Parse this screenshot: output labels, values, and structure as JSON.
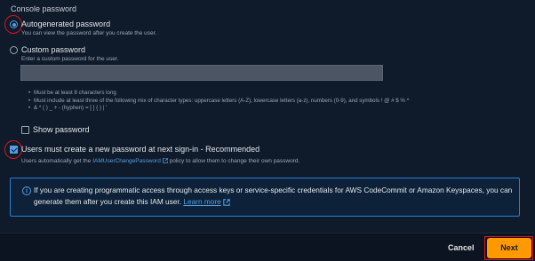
{
  "console_password": {
    "section_title": "Console password",
    "autogenerated": {
      "label": "Autogenerated password",
      "description": "You can view the password after you create the user.",
      "selected": true
    },
    "custom": {
      "label": "Custom password",
      "description": "Enter a custom password for the user.",
      "selected": false,
      "value": ""
    },
    "rules": [
      "Must be at least 8 characters long",
      "Must include at least three of the following mix of character types: uppercase letters (A-Z), lowercase letters (a-z), numbers (0-9), and symbols ! @ # $ % ^",
      "& * ( ) _ + - (hyphen) = [ ] { } | '"
    ],
    "show_password": {
      "label": "Show password",
      "checked": false
    },
    "require_reset": {
      "label": "Users must create a new password at next sign-in - Recommended",
      "checked": true,
      "desc_prefix": "Users automatically get the",
      "policy_link": "IAMUserChangePassword",
      "desc_suffix": "policy to allow them to change their own password."
    }
  },
  "info_alert": {
    "icon": "info-icon",
    "text": "If you are creating programmatic access through access keys or service-specific credentials for AWS CodeCommit or Amazon Keyspaces, you can generate them after you create this IAM user.",
    "link": "Learn more"
  },
  "footer": {
    "cancel_label": "Cancel",
    "next_label": "Next"
  },
  "colors": {
    "background": "#0f1b2a",
    "accent": "#539fe5",
    "primary_button": "#ff9900",
    "highlight_ring": "#e0141e"
  }
}
